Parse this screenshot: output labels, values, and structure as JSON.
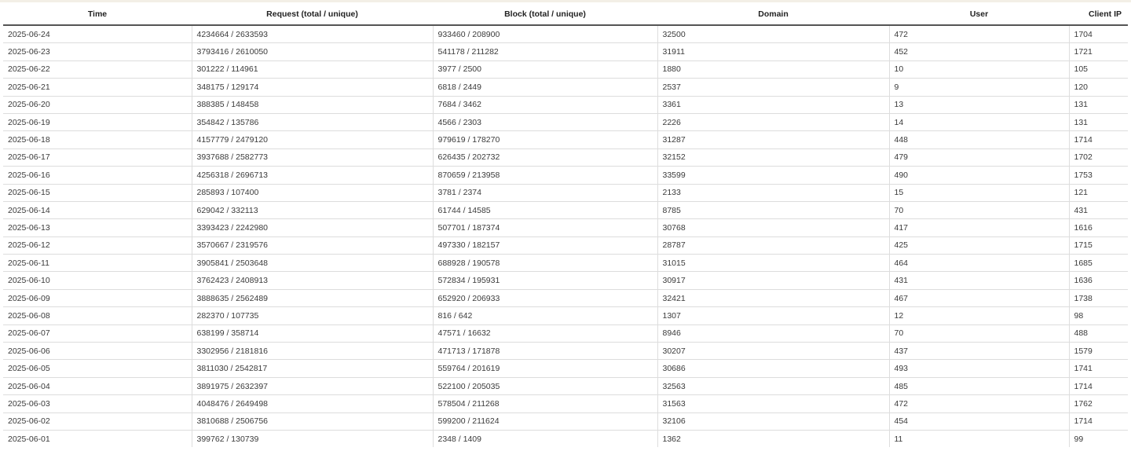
{
  "table": {
    "headers": [
      "Time",
      "Request (total / unique)",
      "Block (total / unique)",
      "Domain",
      "User",
      "Client IP"
    ],
    "rows": [
      [
        "2025-06-24",
        "4234664 / 2633593",
        "933460 / 208900",
        "32500",
        "472",
        "1704"
      ],
      [
        "2025-06-23",
        "3793416 / 2610050",
        "541178 / 211282",
        "31911",
        "452",
        "1721"
      ],
      [
        "2025-06-22",
        "301222 / 114961",
        "3977 / 2500",
        "1880",
        "10",
        "105"
      ],
      [
        "2025-06-21",
        "348175 / 129174",
        "6818 / 2449",
        "2537",
        "9",
        "120"
      ],
      [
        "2025-06-20",
        "388385 / 148458",
        "7684 / 3462",
        "3361",
        "13",
        "131"
      ],
      [
        "2025-06-19",
        "354842 / 135786",
        "4566 / 2303",
        "2226",
        "14",
        "131"
      ],
      [
        "2025-06-18",
        "4157779 / 2479120",
        "979619 / 178270",
        "31287",
        "448",
        "1714"
      ],
      [
        "2025-06-17",
        "3937688 / 2582773",
        "626435 / 202732",
        "32152",
        "479",
        "1702"
      ],
      [
        "2025-06-16",
        "4256318 / 2696713",
        "870659 / 213958",
        "33599",
        "490",
        "1753"
      ],
      [
        "2025-06-15",
        "285893 / 107400",
        "3781 / 2374",
        "2133",
        "15",
        "121"
      ],
      [
        "2025-06-14",
        "629042 / 332113",
        "61744 / 14585",
        "8785",
        "70",
        "431"
      ],
      [
        "2025-06-13",
        "3393423 / 2242980",
        "507701 / 187374",
        "30768",
        "417",
        "1616"
      ],
      [
        "2025-06-12",
        "3570667 / 2319576",
        "497330 / 182157",
        "28787",
        "425",
        "1715"
      ],
      [
        "2025-06-11",
        "3905841 / 2503648",
        "688928 / 190578",
        "31015",
        "464",
        "1685"
      ],
      [
        "2025-06-10",
        "3762423 / 2408913",
        "572834 / 195931",
        "30917",
        "431",
        "1636"
      ],
      [
        "2025-06-09",
        "3888635 / 2562489",
        "652920 / 206933",
        "32421",
        "467",
        "1738"
      ],
      [
        "2025-06-08",
        "282370 / 107735",
        "816 / 642",
        "1307",
        "12",
        "98"
      ],
      [
        "2025-06-07",
        "638199 / 358714",
        "47571 / 16632",
        "8946",
        "70",
        "488"
      ],
      [
        "2025-06-06",
        "3302956 / 2181816",
        "471713 / 171878",
        "30207",
        "437",
        "1579"
      ],
      [
        "2025-06-05",
        "3811030 / 2542817",
        "559764 / 201619",
        "30686",
        "493",
        "1741"
      ],
      [
        "2025-06-04",
        "3891975 / 2632397",
        "522100 / 205035",
        "32563",
        "485",
        "1714"
      ],
      [
        "2025-06-03",
        "4048476 / 2649498",
        "578504 / 211268",
        "31563",
        "472",
        "1762"
      ],
      [
        "2025-06-02",
        "3810688 / 2506756",
        "599200 / 211624",
        "32106",
        "454",
        "1714"
      ],
      [
        "2025-06-01",
        "399762 / 130739",
        "2348 / 1409",
        "1362",
        "11",
        "99"
      ]
    ]
  }
}
